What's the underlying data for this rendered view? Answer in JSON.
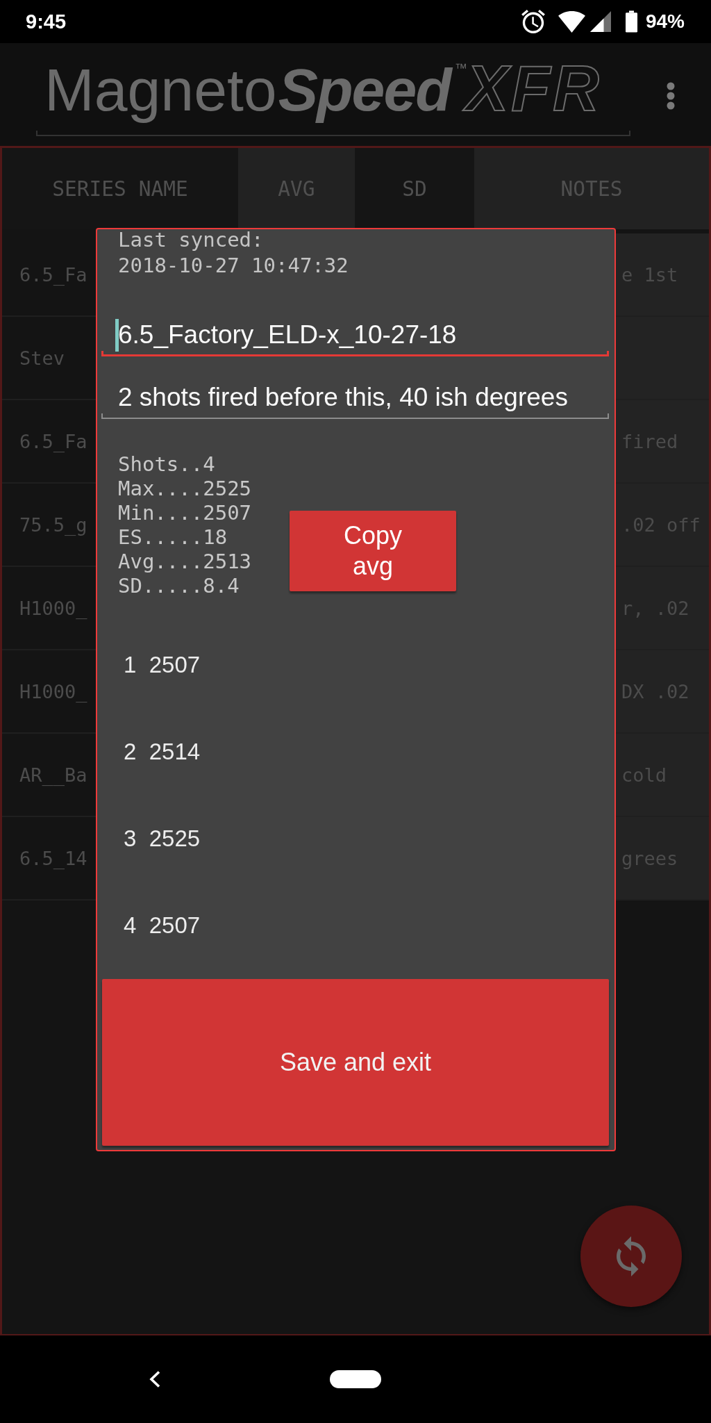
{
  "status_bar": {
    "time": "9:45",
    "battery_percent": "94%"
  },
  "app_bar": {
    "logo": {
      "light_word": "Magneto",
      "bold_word": "Speed",
      "trademark": "™",
      "model": "XFR"
    }
  },
  "table": {
    "columns": [
      {
        "label": "SERIES NAME"
      },
      {
        "label": "AVG"
      },
      {
        "label": "SD"
      },
      {
        "label": "NOTES"
      }
    ],
    "rows": [
      {
        "series_name": "6.5_Fa",
        "notes": "e 1st"
      },
      {
        "series_name": "Stev"
      },
      {
        "series_name": "6.5_Fa",
        "notes": "fired"
      },
      {
        "series_name": "75.5_g",
        "notes": ".02 off"
      },
      {
        "series_name": "H1000_",
        "notes": "r, .02"
      },
      {
        "series_name": "H1000_",
        "notes": "DX .02"
      },
      {
        "series_name": "AR__Ba",
        "notes": "cold"
      },
      {
        "series_name": "6.5_14",
        "notes": "grees"
      }
    ]
  },
  "dialog": {
    "sync_label": "Last synced:",
    "sync_time": "2018-10-27 10:47:32",
    "name_field": {
      "value": "6.5_Factory_ELD-x_10-27-18",
      "focused": true
    },
    "notes_field": {
      "value": "2 shots fired before this, 40 ish degrees",
      "focused": false
    },
    "stats": [
      "Shots..4",
      "Max....2525",
      "Min....2507",
      "ES.....18",
      "Avg....2513",
      "SD.....8.4"
    ],
    "copy_button": "Copy avg",
    "shots": [
      "1  2507",
      "2  2514",
      "3  2525",
      "4  2507"
    ],
    "save_button": "Save and exit"
  }
}
